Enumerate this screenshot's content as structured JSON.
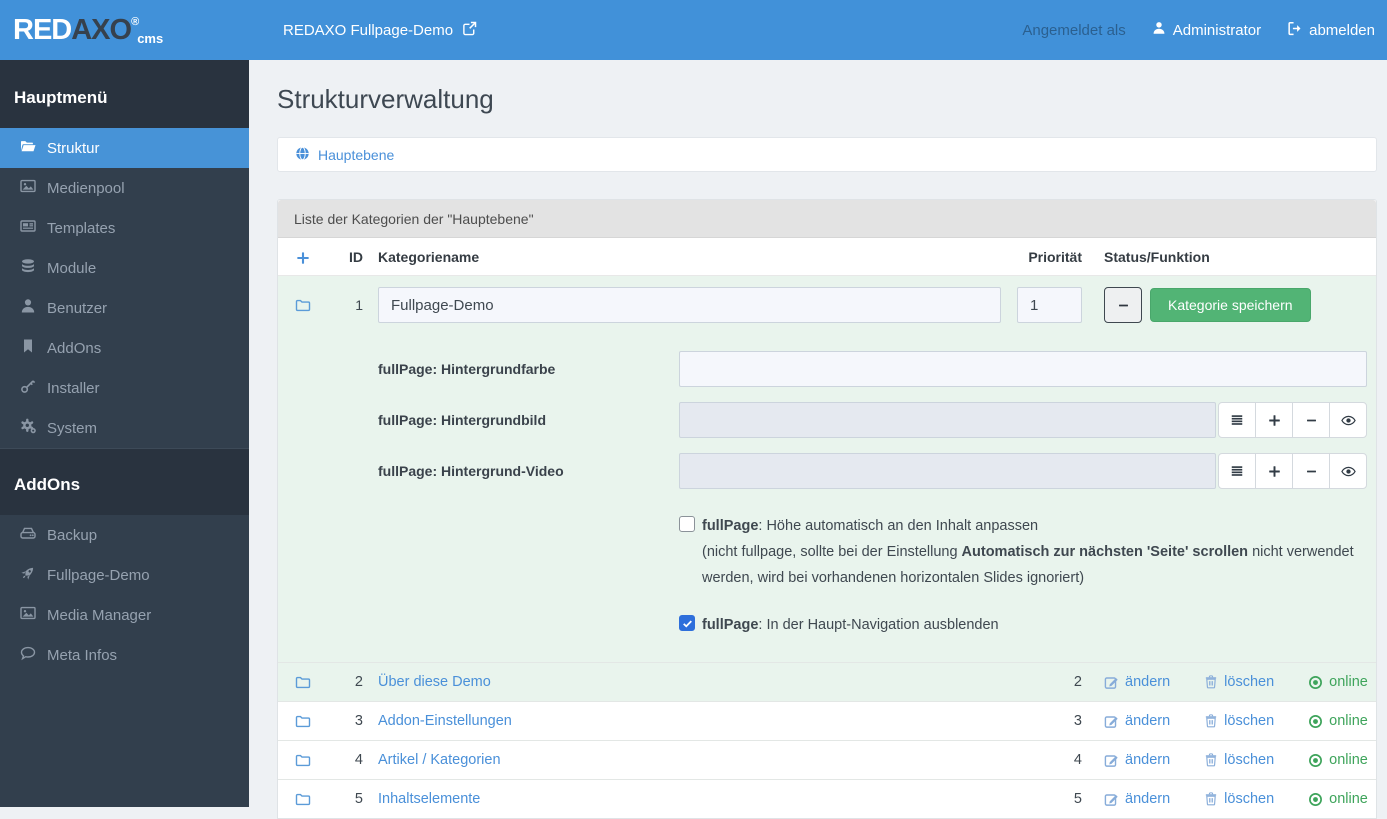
{
  "header": {
    "logo": {
      "red": "RED",
      "axo": "AXO",
      "reg": "®",
      "cms": "cms"
    },
    "site_link": "REDAXO Fullpage-Demo",
    "logged_in_as": "Angemeldet als",
    "user": "Administrator",
    "logout": "abmelden"
  },
  "sidebar": {
    "main_title": "Hauptmenü",
    "main_items": [
      {
        "label": "Struktur",
        "icon": "folder-open-icon",
        "active": true
      },
      {
        "label": "Medienpool",
        "icon": "image-icon",
        "active": false
      },
      {
        "label": "Templates",
        "icon": "newspaper-icon",
        "active": false
      },
      {
        "label": "Module",
        "icon": "database-icon",
        "active": false
      },
      {
        "label": "Benutzer",
        "icon": "user-icon",
        "active": false
      },
      {
        "label": "AddOns",
        "icon": "bookmark-icon",
        "active": false
      },
      {
        "label": "Installer",
        "icon": "key-icon",
        "active": false
      },
      {
        "label": "System",
        "icon": "cogs-icon",
        "active": false
      }
    ],
    "addons_title": "AddOns",
    "addon_items": [
      {
        "label": "Backup",
        "icon": "hdd-icon"
      },
      {
        "label": "Fullpage-Demo",
        "icon": "rocket-icon"
      },
      {
        "label": "Media Manager",
        "icon": "image-icon"
      },
      {
        "label": "Meta Infos",
        "icon": "comment-icon"
      }
    ]
  },
  "page": {
    "title": "Strukturverwaltung",
    "breadcrumb": {
      "label": "Hauptebene",
      "icon": "globe-icon"
    }
  },
  "panel": {
    "header": "Liste der Kategorien der \"Hauptebene\"",
    "columns": {
      "add": "+",
      "id": "ID",
      "name": "Kategoriename",
      "priority": "Priorität",
      "status": "Status/Funktion"
    },
    "edit_row": {
      "id": "1",
      "name_value": "Fullpage-Demo",
      "priority_value": "1",
      "minus_label": "−",
      "save_label": "Kategorie speichern"
    },
    "meta_fields": [
      {
        "label": "fullPage: Hintergrundfarbe",
        "type": "text",
        "value": ""
      },
      {
        "label": "fullPage: Hintergrundbild",
        "type": "media",
        "value": "",
        "buttons": [
          "list-icon",
          "plus-icon",
          "minus-icon",
          "eye-icon"
        ]
      },
      {
        "label": "fullPage: Hintergrund-Video",
        "type": "media",
        "value": "",
        "buttons": [
          "list-icon",
          "plus-icon",
          "minus-icon",
          "eye-icon"
        ]
      }
    ],
    "checkboxes": [
      {
        "checked": false,
        "label_bold": "fullPage",
        "label_rest": ": Höhe automatisch an den Inhalt anpassen",
        "note_pre": "(nicht fullpage, sollte bei der Einstellung ",
        "note_bold": "Automatisch zur nächsten 'Seite' scrollen",
        "note_post": " nicht verwendet werden, wird bei vorhandenen horizontalen Slides ignoriert)"
      },
      {
        "checked": true,
        "check_glyph": "✓",
        "label_bold": "fullPage",
        "label_rest": ": In der Haupt-Navigation ausblenden"
      }
    ],
    "rows": [
      {
        "id": "2",
        "name": "Über diese Demo",
        "priority": "2"
      },
      {
        "id": "3",
        "name": "Addon-Einstellungen",
        "priority": "3"
      },
      {
        "id": "4",
        "name": "Artikel / Kategorien",
        "priority": "4"
      },
      {
        "id": "5",
        "name": "Inhaltselemente",
        "priority": "5"
      }
    ],
    "actions": {
      "edit": "ändern",
      "edit_icon": "pencil-square-icon",
      "delete": "löschen",
      "delete_icon": "trash-icon",
      "status": "online",
      "status_icon": "dot-circle-icon"
    }
  },
  "colors": {
    "header_blue": "#4191d9",
    "sidebar_bg": "#323f4d",
    "sidebar_title_bg": "#29333f",
    "active_item_blue": "#4793d7",
    "link_blue": "#4a90d9",
    "save_green": "#52b475",
    "online_green": "#3ea45b",
    "edit_zone_green": "#e9f4ed",
    "panel_head_gray": "#e3e3e3",
    "checkbox_blue": "#2e6fdb"
  }
}
